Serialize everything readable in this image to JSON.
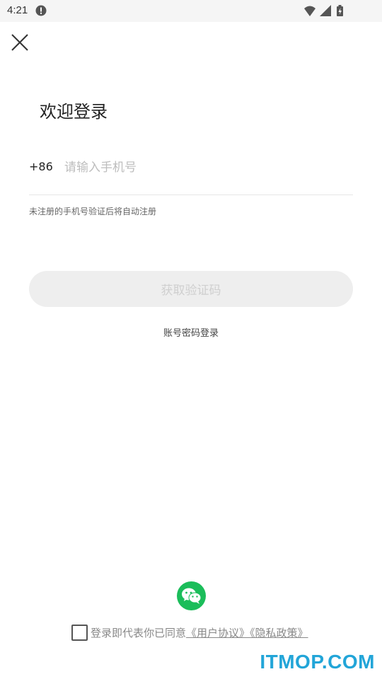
{
  "status_bar": {
    "time": "4:21",
    "icons": [
      "alert-icon",
      "wifi-icon",
      "signal-icon",
      "battery-charging-icon"
    ]
  },
  "header": {
    "close_icon": "close-icon"
  },
  "main": {
    "title": "欢迎登录",
    "country_code": "+86",
    "phone_placeholder": "请输入手机号",
    "phone_value": "",
    "hint": "未注册的手机号验证后将自动注册",
    "get_code_label": "获取验证码",
    "password_login_label": "账号密码登录"
  },
  "footer": {
    "wechat_icon": "wechat-icon",
    "wechat_color": "#1bbd5a",
    "agree_prefix": "登录即代表你已同意",
    "user_agreement": "《用户协议》",
    "privacy_policy": "《隐私政策》",
    "agree_checked": false
  },
  "watermark": "ITMOP.COM"
}
